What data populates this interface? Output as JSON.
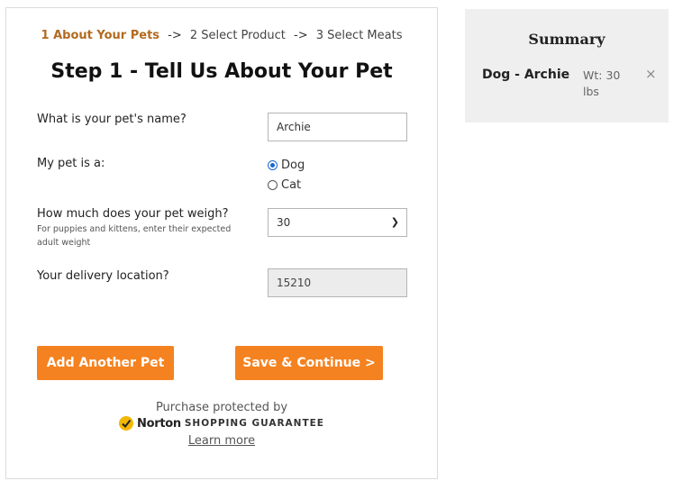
{
  "steps": {
    "step1": "1 About Your Pets",
    "arrow1": "->",
    "step2": "2 Select Product",
    "arrow2": "->",
    "step3": "3 Select Meats"
  },
  "title": "Step 1 - Tell Us About Your Pet",
  "form": {
    "name_label": "What is your pet's name?",
    "name_value": "Archie",
    "type_label": "My pet is a:",
    "type_options": [
      "Dog",
      "Cat"
    ],
    "type_selected": "Dog",
    "weight_label": "How much does your pet weigh?",
    "weight_hint": "For puppies and kittens, enter their expected adult weight",
    "weight_value": "30",
    "location_label": "Your delivery location?",
    "location_value": "15210"
  },
  "buttons": {
    "add_pet": "Add Another Pet",
    "save_continue": "Save & Continue >"
  },
  "trust": {
    "protected": "Purchase protected by",
    "brand": "Norton",
    "guarantee": "SHOPPING GUARANTEE",
    "learn_more": "Learn more"
  },
  "summary": {
    "title": "Summary",
    "pet": "Dog - Archie",
    "weight": "Wt: 30 lbs",
    "remove": "×"
  },
  "colors": {
    "accent": "#f58220",
    "step_active": "#b36a1f",
    "radio": "#1a66d6",
    "summary_bg": "#efefef"
  }
}
